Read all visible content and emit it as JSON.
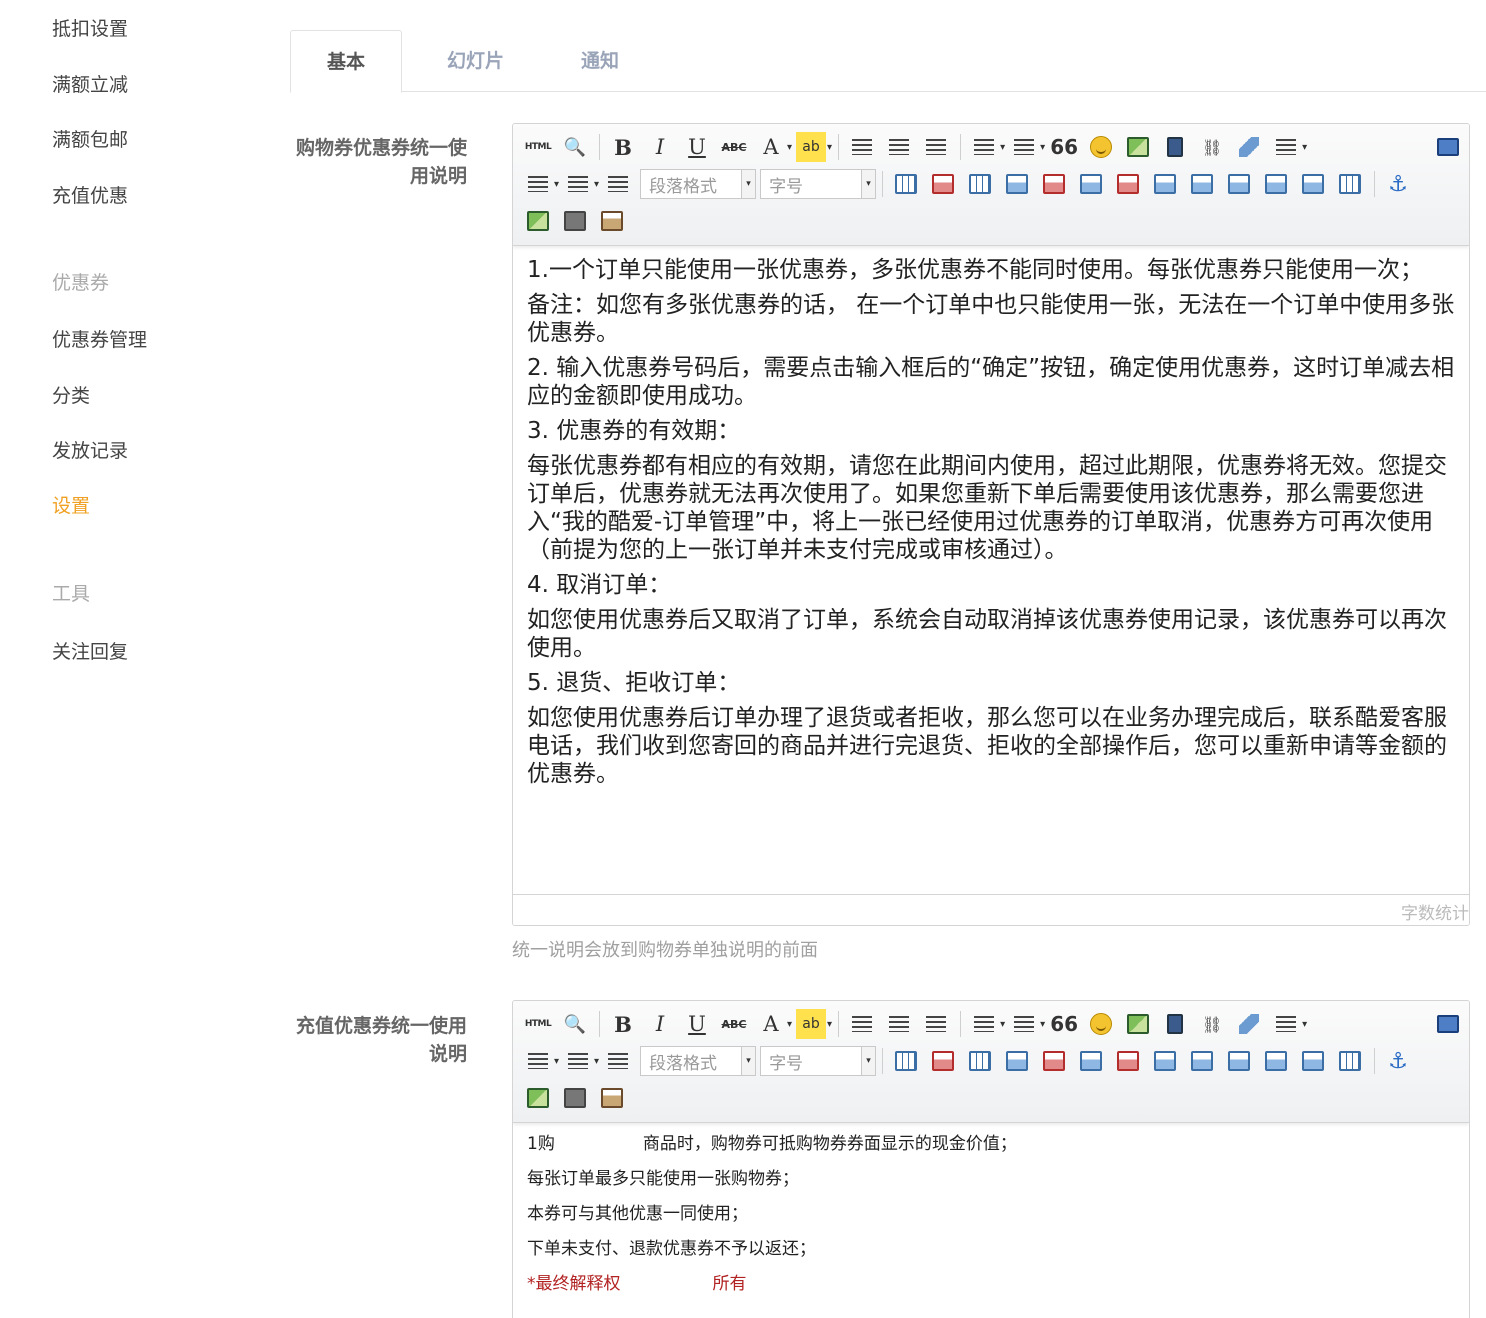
{
  "sidebar": {
    "items_top": [
      "抵扣设置",
      "满额立减",
      "满额包邮",
      "充值优惠"
    ],
    "coupon_heading": "优惠券",
    "coupon_items": [
      "优惠券管理",
      "分类",
      "发放记录",
      "设置"
    ],
    "active_item": "设置",
    "tools_heading": "工具",
    "tools_items": [
      "关注回复"
    ]
  },
  "tabs": {
    "basic": "基本",
    "slides": "幻灯片",
    "notice": "通知"
  },
  "toolbar": {
    "html_label": "HTML",
    "paragraph_format": "段落格式",
    "font_size": "字号",
    "bold": "B",
    "italic": "I",
    "underline": "U",
    "strike": "ABC",
    "font_color": "A",
    "quote": "66"
  },
  "shopping_coupon": {
    "label": "购物券优惠券统一使用说明",
    "paragraphs": [
      "1.一个订单只能使用一张优惠券，多张优惠券不能同时使用。每张优惠券只能使用一次；",
      "备注：如您有多张优惠券的话， 在一个订单中也只能使用一张，无法在一个订单中使用多张优惠券。",
      "2. 输入优惠券号码后，需要点击输入框后的“确定”按钮，确定使用优惠券，这时订单减去相应的金额即使用成功。",
      "3. 优惠券的有效期：",
      "每张优惠券都有相应的有效期，请您在此期间内使用，超过此期限，优惠券将无效。您提交订单后，优惠券就无法再次使用了。如果您重新下单后需要使用该优惠券，那么需要您进入“我的酷爱-订单管理”中，将上一张已经使用过优惠券的订单取消，优惠券方可再次使用（前提为您的上一张订单并未支付完成或审核通过）。",
      "4. 取消订单：",
      "如您使用优惠券后又取消了订单，系统会自动取消掉该优惠券使用记录，该优惠券可以再次使用。",
      "5. 退货、拒收订单：",
      "如您使用优惠券后订单办理了退货或者拒收，那么您可以在业务办理完成后，联系酷爱客服电话，我们收到您寄回的商品并进行完退货、拒收的全部操作后，您可以重新申请等金额的优惠券。"
    ],
    "word_count": "字数统计",
    "help_text": "统一说明会放到购物券单独说明的前面"
  },
  "recharge_coupon": {
    "label": "充值优惠券统一使用说明",
    "line1_a": "1购",
    "line1_b": "商品时，购物券可抵购物券券面显示的现金价值；",
    "line2": "每张订单最多只能使用一张购物券；",
    "line3": "本券可与其他优惠一同使用；",
    "line4": "下单未支付、退款优惠券不予以返还；",
    "line5_a": "*最终解释权",
    "line5_b": "所有"
  }
}
